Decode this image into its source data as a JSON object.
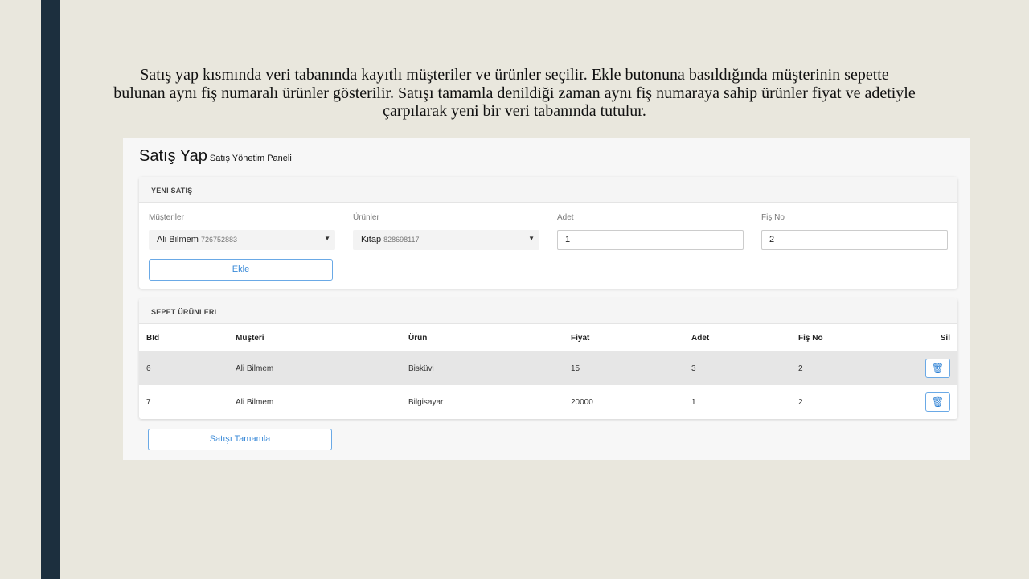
{
  "caption": "Satış yap kısmında veri tabanında kayıtlı müşteriler ve ürünler seçilir. Ekle butonuna basıldığında müşterinin sepette bulunan aynı fiş numaralı ürünler gösterilir. Satışı tamamla denildiği zaman aynı fiş numaraya sahip ürünler fiyat ve adetiyle çarpılarak yeni bir veri tabanında tutulur.",
  "page": {
    "title": "Satış Yap",
    "subtitle": "Satış Yönetim Paneli"
  },
  "new_sale": {
    "header": "YENI SATIŞ",
    "customers_label": "Müşteriler",
    "customer_name": "Ali Bilmem",
    "customer_id": "726752883",
    "products_label": "Ürünler",
    "product_name": "Kitap",
    "product_id": "828698117",
    "qty_label": "Adet",
    "qty_value": "1",
    "receipt_label": "Fiş No",
    "receipt_value": "2",
    "add_label": "Ekle"
  },
  "cart": {
    "header": "SEPET ÜRÜNLERI",
    "columns": [
      "BId",
      "Müşteri",
      "Ürün",
      "Fiyat",
      "Adet",
      "Fiş No",
      "Sil"
    ],
    "rows": [
      [
        "6",
        "Ali Bilmem",
        "Bisküvi",
        "15",
        "3",
        "2"
      ],
      [
        "7",
        "Ali Bilmem",
        "Bilgisayar",
        "20000",
        "1",
        "2"
      ]
    ],
    "complete_label": "Satışı Tamamla"
  },
  "colors": {
    "accent": "#3a8ad8",
    "sidebar": "#1c2f3e"
  }
}
